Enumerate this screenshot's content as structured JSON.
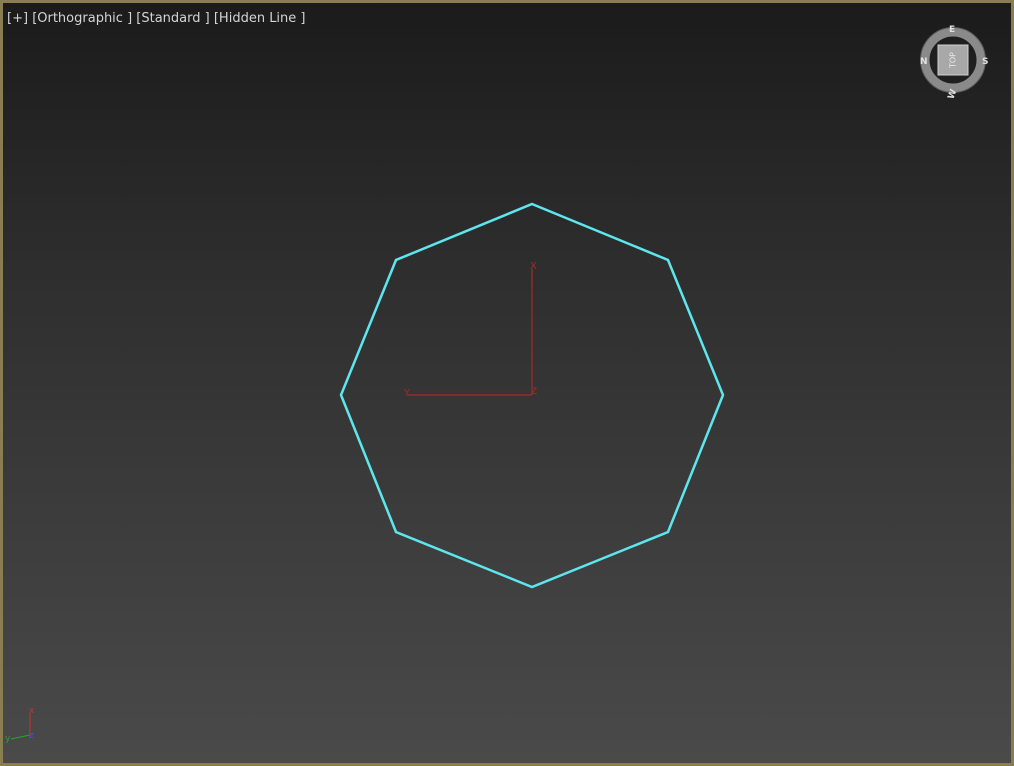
{
  "viewport": {
    "labels": {
      "plus": "[+]",
      "projection": "[Orthographic ]",
      "preset": "[Standard ]",
      "shading": "[Hidden Line ]"
    },
    "selection_color": "#5ee6ef",
    "border_color": "#8a7d52"
  },
  "gizmo": {
    "x_label": "X",
    "y_label": "Y",
    "z_label": "Z",
    "color": "#a52a2a"
  },
  "viewcube": {
    "face_label": "TOP",
    "compass": {
      "north": "N",
      "south": "S",
      "east": "E",
      "west": "W"
    }
  },
  "axis_tripod": {
    "x_label": "x",
    "y_label": "y",
    "z_label": "z",
    "x_color": "#c83232",
    "y_color": "#2ea02e",
    "z_color": "#3a5ad0"
  }
}
